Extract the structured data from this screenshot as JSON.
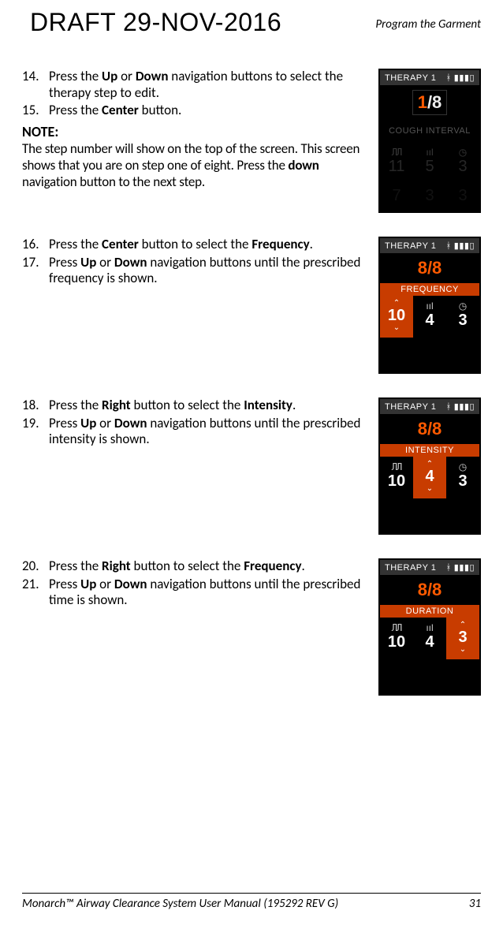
{
  "header": {
    "draft": "DRAFT 29-NOV-2016",
    "section_title": "Program the Garment"
  },
  "steps": {
    "s14_num": "14.",
    "s14": "Press the <b>Up</b> or <b>Down</b> navigation buttons to select the therapy step to edit.",
    "s15_num": "15.",
    "s15": "Press the <b>Center</b> button.",
    "note_h": "NOTE:",
    "note_body": "The step number will show on the top of the screen. This screen shows that you are on step one of eight. Press the <b>down</b> navigation button to the next step.",
    "s16_num": "16.",
    "s16": "Press the <b>Center</b> button to select the <b>Frequency</b>.",
    "s17_num": "17.",
    "s17": "Press <b>Up</b> or <b>Down</b> navigation buttons until the prescribed frequency is shown.",
    "s18_num": "18.",
    "s18": "Press the <b>Right</b> button to select the <b>Intensity</b>.",
    "s19_num": "19.",
    "s19": "Press <b>Up</b> or <b>Down</b> navigation buttons until the prescribed intensity is shown.",
    "s20_num": "20.",
    "s20": "Press the <b>Right</b> button to select the <b>Frequency</b>.",
    "s21_num": "21.",
    "s21": "Press <b>Up</b> or <b>Down</b> navigation buttons until the prescribed time is shown."
  },
  "devices": {
    "d1": {
      "title": "THERAPY 1",
      "step_cur": "1",
      "step_tot": "/8",
      "label": "COUGH INTERVAL",
      "freq": "11",
      "int": "5",
      "dur": "3",
      "freq2": "7",
      "int2": "3",
      "dur2": "3"
    },
    "d2": {
      "title": "THERAPY 1",
      "step": "8/8",
      "label": "FREQUENCY",
      "freq": "10",
      "int": "4",
      "dur": "3"
    },
    "d3": {
      "title": "THERAPY 1",
      "step": "8/8",
      "label": "INTENSITY",
      "freq": "10",
      "int": "4",
      "dur": "3"
    },
    "d4": {
      "title": "THERAPY 1",
      "step": "8/8",
      "label": "DURATION",
      "freq": "10",
      "int": "4",
      "dur": "3"
    }
  },
  "footer": {
    "left": "Monarch™ Airway Clearance System User Manual (195292 REV G)",
    "right": "31"
  }
}
